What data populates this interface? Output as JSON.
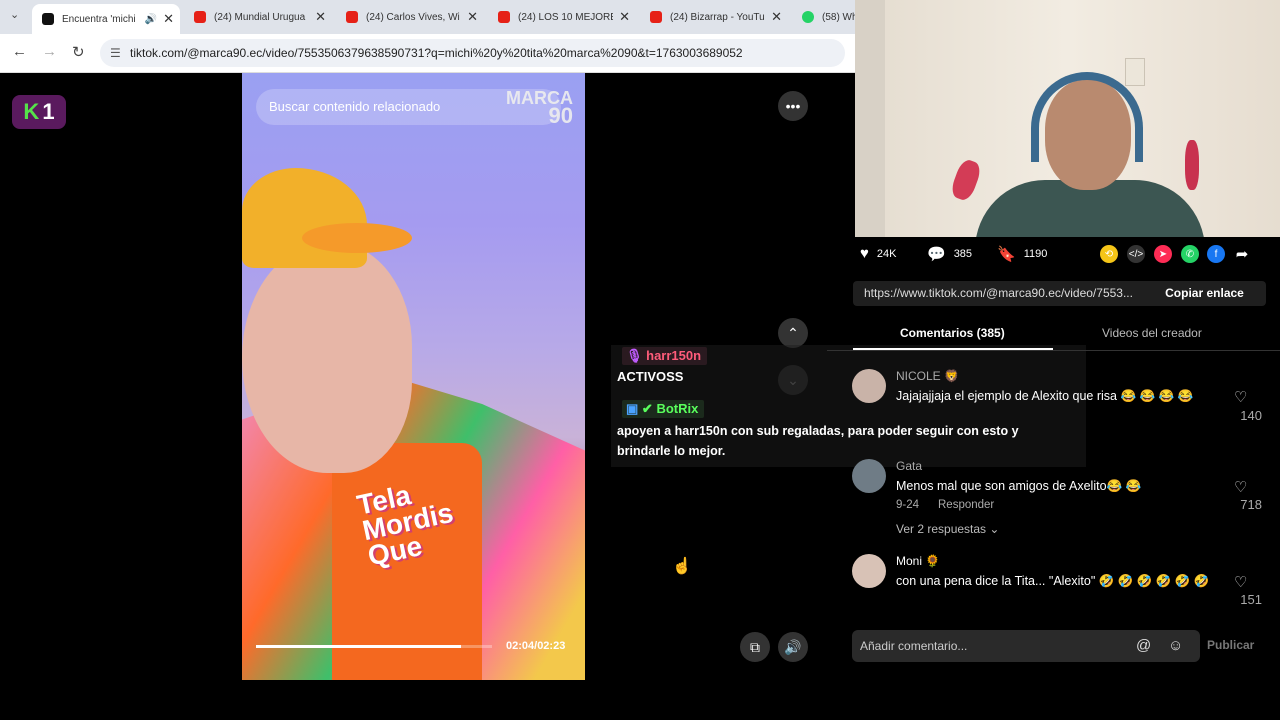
{
  "browser": {
    "tabs": [
      {
        "title": "Encuentra 'michi",
        "color": "#111111",
        "active": true
      },
      {
        "title": "(24) Mundial Urugua",
        "color": "#e62117",
        "active": false
      },
      {
        "title": "(24) Carlos Vives, Wi",
        "color": "#e62117",
        "active": false
      },
      {
        "title": "(24) LOS 10 MEJORE",
        "color": "#e62117",
        "active": false
      },
      {
        "title": "(24) Bizarrap - YouTu",
        "color": "#e62117",
        "active": false
      },
      {
        "title": "(58) Wh",
        "color": "#25d366",
        "active": false
      }
    ],
    "url": "tiktok.com/@marca90.ec/video/7553506379638590731?q=michi%20y%20tita%20marca%2090&t=1763003689052"
  },
  "channel_logo": {
    "letter": "K",
    "number": "1"
  },
  "video": {
    "search_placeholder": "Buscar contenido relacionado",
    "watermark_line1": "MARCA",
    "watermark_line2": "90",
    "shirt_text": "Tela\nMordis\nQue",
    "time": "02:04/02:23",
    "progress": 0.87
  },
  "chat": [
    {
      "user": "harr150n",
      "badge_color": "#ff5c7a",
      "message": "ACTIVOSS"
    },
    {
      "user": "BotRix",
      "badge_color": "#59ff5c",
      "message": "apoyen a harr150n con sub regaladas, para poder seguir con esto y brindarle lo mejor."
    }
  ],
  "stats": {
    "likes": "24K",
    "comments": "385",
    "saves": "1190"
  },
  "share_link": {
    "url": "https://www.tiktok.com/@marca90.ec/video/7553...",
    "copy_label": "Copiar enlace"
  },
  "tabs": {
    "comments": "Comentarios (385)",
    "creator": "Videos del creador"
  },
  "comments": [
    {
      "user": "NICOLE 🦁",
      "text": "Jajajajjaja el ejemplo de Alexito que risa 😂 😂 😂 😂",
      "likes": "140"
    },
    {
      "user": "Gata",
      "text": "Menos mal que son amigos de Axelito😂 😂",
      "date": "9-24",
      "reply": "Responder",
      "likes": "718",
      "replies": "Ver 2 respuestas ⌄"
    },
    {
      "user": "Moni 🌻",
      "text": "con una pena dice la Tita... \"Alexito\" 🤣 🤣 🤣 🤣 🤣 🤣",
      "likes": "151"
    }
  ],
  "input": {
    "placeholder": "Añadir comentario...",
    "publish": "Publicar"
  }
}
